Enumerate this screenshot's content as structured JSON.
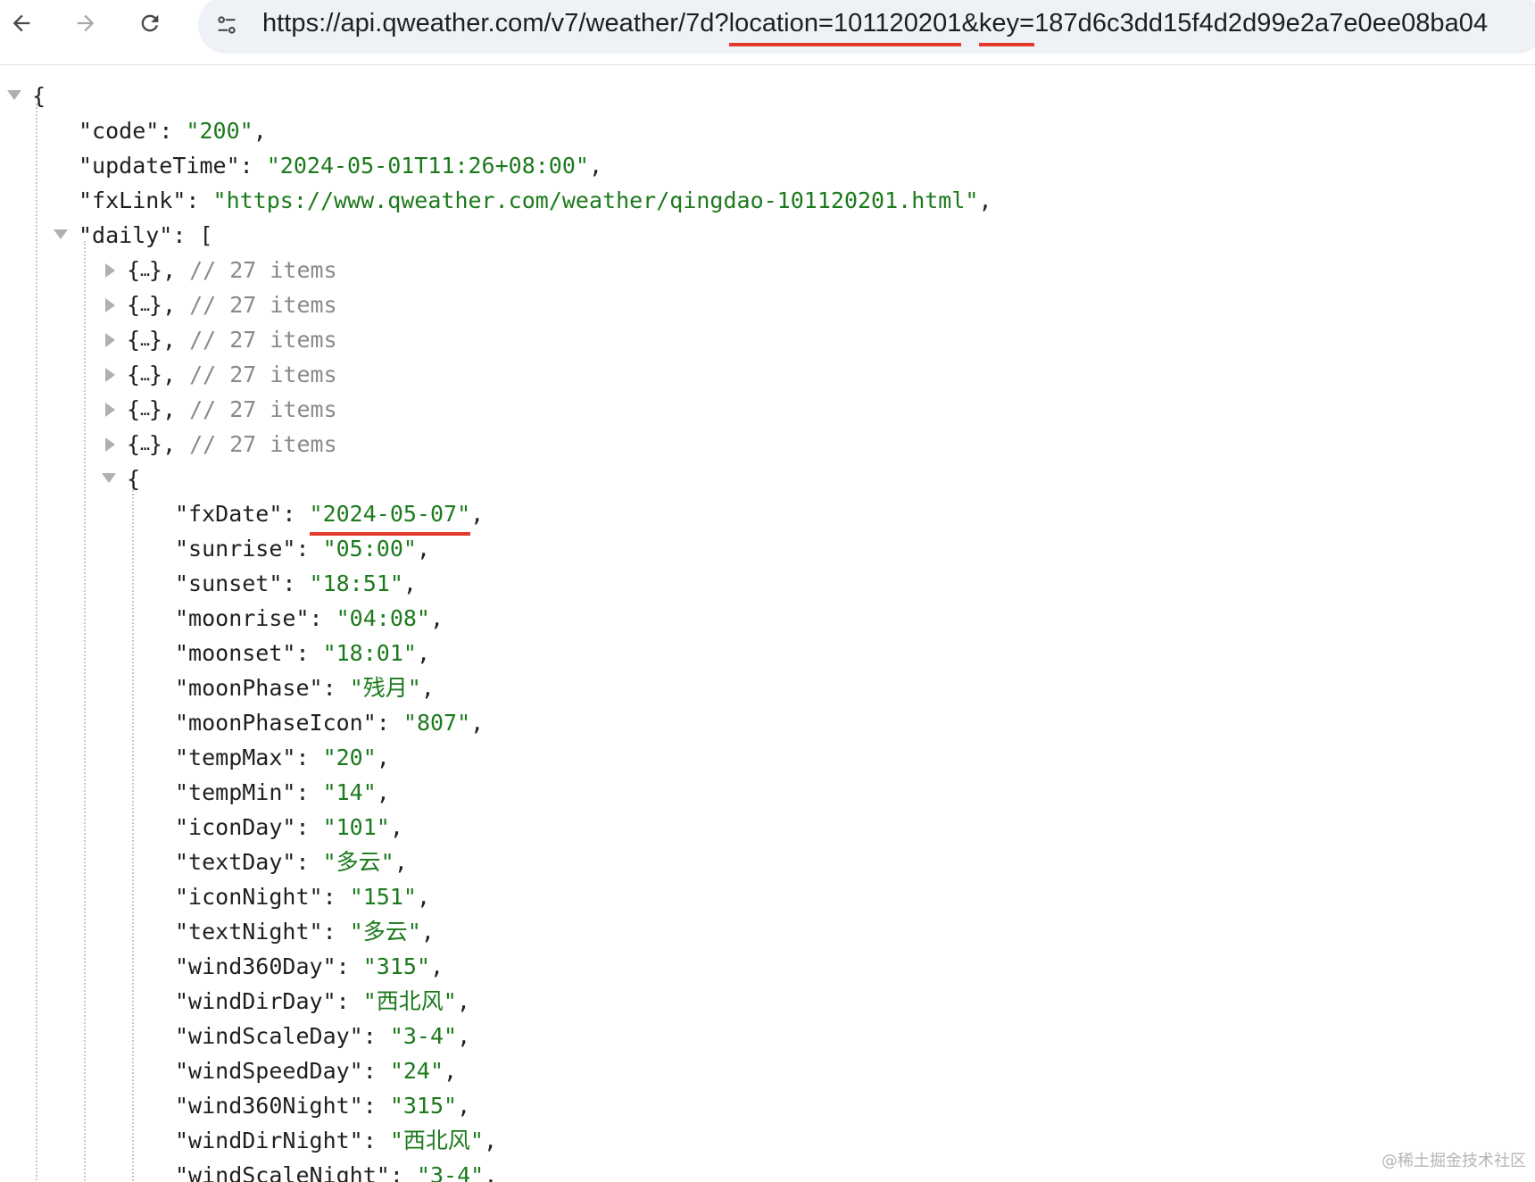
{
  "browser": {
    "url_prefix": "https://api.qweather.com/v7/weather/7d?",
    "url_location": "location=101120201",
    "url_amp": "&",
    "url_key_label": "key=",
    "url_key_value": "187d6c3dd15f4d2d99e2a7e0ee08ba04",
    "highlight_color": "#e33a2b"
  },
  "json": {
    "open_brace": "{",
    "code_key": "\"code\"",
    "code_val": "\"200\"",
    "updateTime_key": "\"updateTime\"",
    "updateTime_val": "\"2024-05-01T11:26+08:00\"",
    "fxLink_key": "\"fxLink\"",
    "fxLink_val": "\"https://www.qweather.com/weather/qingdao-101120201.html\"",
    "daily_key": "\"daily\"",
    "daily_open": "[",
    "collapsed_comment": "// 27 items",
    "collapsed_count": 6,
    "expanded_open": "{",
    "fields": [
      {
        "key": "\"fxDate\"",
        "val": "\"2024-05-07\""
      },
      {
        "key": "\"sunrise\"",
        "val": "\"05:00\""
      },
      {
        "key": "\"sunset\"",
        "val": "\"18:51\""
      },
      {
        "key": "\"moonrise\"",
        "val": "\"04:08\""
      },
      {
        "key": "\"moonset\"",
        "val": "\"18:01\""
      },
      {
        "key": "\"moonPhase\"",
        "val": "\"残月\""
      },
      {
        "key": "\"moonPhaseIcon\"",
        "val": "\"807\""
      },
      {
        "key": "\"tempMax\"",
        "val": "\"20\""
      },
      {
        "key": "\"tempMin\"",
        "val": "\"14\""
      },
      {
        "key": "\"iconDay\"",
        "val": "\"101\""
      },
      {
        "key": "\"textDay\"",
        "val": "\"多云\""
      },
      {
        "key": "\"iconNight\"",
        "val": "\"151\""
      },
      {
        "key": "\"textNight\"",
        "val": "\"多云\""
      },
      {
        "key": "\"wind360Day\"",
        "val": "\"315\""
      },
      {
        "key": "\"windDirDay\"",
        "val": "\"西北风\""
      },
      {
        "key": "\"windScaleDay\"",
        "val": "\"3-4\""
      },
      {
        "key": "\"windSpeedDay\"",
        "val": "\"24\""
      },
      {
        "key": "\"wind360Night\"",
        "val": "\"315\""
      },
      {
        "key": "\"windDirNight\"",
        "val": "\"西北风\""
      },
      {
        "key": "\"windScaleNight\"",
        "val": "\"3-4\""
      }
    ]
  },
  "watermark": "@稀土掘金技术社区"
}
